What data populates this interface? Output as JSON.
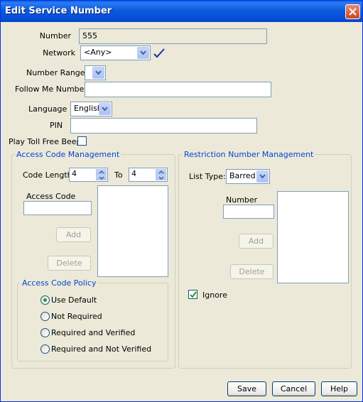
{
  "window": {
    "title": "Edit Service Number"
  },
  "form": {
    "number_label": "Number",
    "number_value": "555",
    "network_label": "Network",
    "network_value": "<Any>",
    "number_range_label": "Number Range",
    "number_range_value": "",
    "follow_me_label": "Follow Me Number",
    "follow_me_value": "",
    "language_label": "Language",
    "language_value": "English",
    "pin_label": "PIN",
    "pin_value": "",
    "play_toll_free_label": "Play Toll Free Beep",
    "play_toll_free_checked": false
  },
  "access_code": {
    "group_title": "Access Code Management",
    "code_length_label": "Code Length",
    "code_length_from": "4",
    "to_label": "To",
    "code_length_to": "4",
    "access_code_label": "Access Code",
    "access_code_value": "",
    "add_label": "Add",
    "delete_label": "Delete",
    "policy": {
      "title": "Access Code Policy",
      "options": [
        "Use Default",
        "Not Required",
        "Required and Verified",
        "Required and Not Verified"
      ],
      "selected": "Use Default"
    }
  },
  "restriction": {
    "group_title": "Restriction Number Management",
    "list_type_label": "List Type:",
    "list_type_value": "Barred",
    "number_label": "Number",
    "number_value": "",
    "add_label": "Add",
    "delete_label": "Delete",
    "ignore_label": "Ignore",
    "ignore_checked": true
  },
  "footer": {
    "save_label": "Save",
    "cancel_label": "Cancel",
    "help_label": "Help"
  },
  "icons": {
    "close": "close-icon",
    "dropdown": "chevron-down-icon",
    "check": "checkmark-icon"
  }
}
